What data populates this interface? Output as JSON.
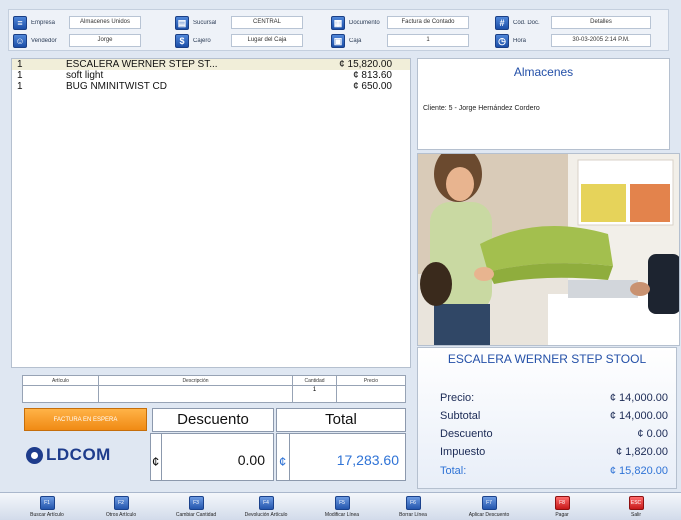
{
  "header": {
    "row1": [
      {
        "label": "Empresa",
        "value": "Almacenes Unidos",
        "icon": "list-icon"
      },
      {
        "label": "Sucursal",
        "value": "CENTRAL",
        "icon": "building-icon"
      },
      {
        "label": "Documento",
        "value": "Factura de Contado",
        "icon": "document-icon"
      },
      {
        "label": "Cód. Doc.",
        "value": "Detalles",
        "icon": "code-icon"
      }
    ],
    "row2": [
      {
        "label": "Vendedor",
        "value": "Jorge",
        "icon": "user-icon"
      },
      {
        "label": "Cajero",
        "value": "Lugar del Caja",
        "icon": "cashier-icon"
      },
      {
        "label": "Caja",
        "value": "1",
        "icon": "register-icon"
      },
      {
        "label": "Hora",
        "value": "30-03-2005 2:14 P.M.",
        "icon": "clock-icon"
      }
    ]
  },
  "items": [
    {
      "qty": "1",
      "desc": "ESCALERA WERNER STEP ST...",
      "price": "¢ 15,820.00",
      "selected": true
    },
    {
      "qty": "1",
      "desc": "soft light",
      "price": "¢ 813.60",
      "selected": false
    },
    {
      "qty": "1",
      "desc": "BUG NMINITWIST CD",
      "price": "¢ 650.00",
      "selected": false
    }
  ],
  "store": {
    "name": "Almacenes",
    "client": "Cliente: 5 - Jorge Hernández Cordero"
  },
  "product": {
    "name": "ESCALERA WERNER STEP STOOL",
    "rows": [
      {
        "label": "Precio:",
        "value": "¢ 14,000.00"
      },
      {
        "label": "Subtotal",
        "value": "¢ 14,000.00"
      },
      {
        "label": "Descuento",
        "value": "¢ 0.00"
      },
      {
        "label": "Impuesto",
        "value": "¢ 1,820.00"
      },
      {
        "label": "Total:",
        "value": "¢ 15,820.00"
      }
    ]
  },
  "entry": {
    "headers": [
      "Artículo",
      "Descripción",
      "Cantidad",
      "Precio"
    ],
    "qty_value": "1"
  },
  "factura_button": "FACTURA EN ESPERA",
  "logo_text": "LDCOM",
  "discount": {
    "label": "Descuento",
    "currency": "¢",
    "amount": "0.00"
  },
  "total": {
    "label": "Total",
    "currency": "¢",
    "amount": "17,283.60"
  },
  "toolbar": [
    {
      "key": "F1",
      "label": "Buscar Artículo"
    },
    {
      "key": "F2",
      "label": "Otros Artículo"
    },
    {
      "key": "F3",
      "label": "Cambiar Cantidad"
    },
    {
      "key": "F4",
      "label": "Devolución Artículo"
    },
    {
      "key": "F5",
      "label": "Modificar Línea"
    },
    {
      "key": "F6",
      "label": "Borrar Línea"
    },
    {
      "key": "F7",
      "label": "Aplicar Descuento"
    },
    {
      "key": "F8",
      "label": "Pagar",
      "red": true
    },
    {
      "key": "ESC",
      "label": "Salir",
      "red": true
    }
  ],
  "colors": {
    "accent_blue": "#2450a8",
    "factura_orange": "#f08a14",
    "total_blue": "#2f73d6"
  }
}
